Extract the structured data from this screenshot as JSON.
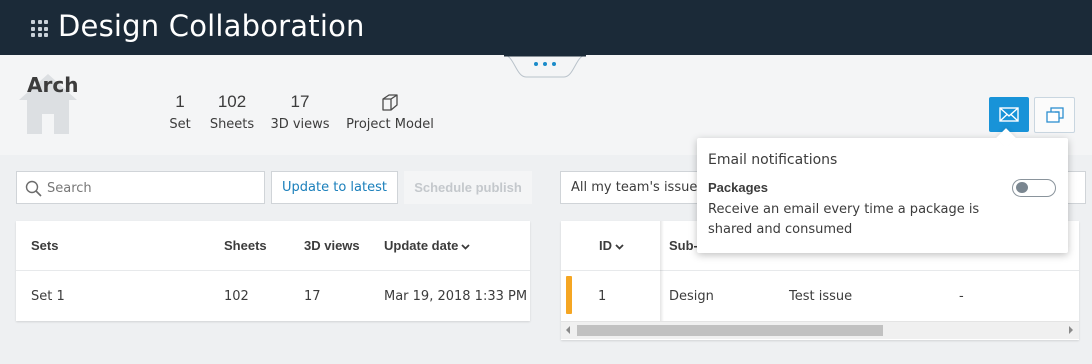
{
  "app": {
    "title": "Design Collaboration"
  },
  "project": {
    "name": "Arch",
    "stats": [
      {
        "value": "1",
        "label": "Set"
      },
      {
        "value": "102",
        "label": "Sheets"
      },
      {
        "value": "17",
        "label": "3D views"
      }
    ],
    "model_label": "Project Model"
  },
  "toolbar": {
    "search_placeholder": "Search",
    "update_label": "Update to latest",
    "schedule_label": "Schedule publish",
    "filter_value": "All my team's issues"
  },
  "sets_table": {
    "headers": {
      "sets": "Sets",
      "sheets": "Sheets",
      "views": "3D views",
      "update_date": "Update date"
    },
    "rows": [
      {
        "set": "Set 1",
        "sheets": "102",
        "views": "17",
        "update_date": "Mar 19, 2018 1:33 PM"
      }
    ]
  },
  "issues_table": {
    "headers": {
      "id": "ID",
      "sub": "Sub-"
    },
    "rows": [
      {
        "id": "1",
        "sub": "Design",
        "title": "Test issue",
        "extra": "-",
        "priority_color": "#f5a623"
      }
    ]
  },
  "notifications": {
    "title": "Email notifications",
    "packages_label": "Packages",
    "packages_desc": "Receive an email every time a package is shared and consumed",
    "packages_enabled": false
  },
  "colors": {
    "topbar": "#1b2a38",
    "accent": "#1893d8",
    "link": "#1a7fbb",
    "priority": "#f5a623"
  },
  "icons": [
    "apps-grid-icon",
    "house-icon",
    "cube-icon",
    "mail-icon",
    "copy-icon",
    "search-icon",
    "sort-down-icon"
  ]
}
